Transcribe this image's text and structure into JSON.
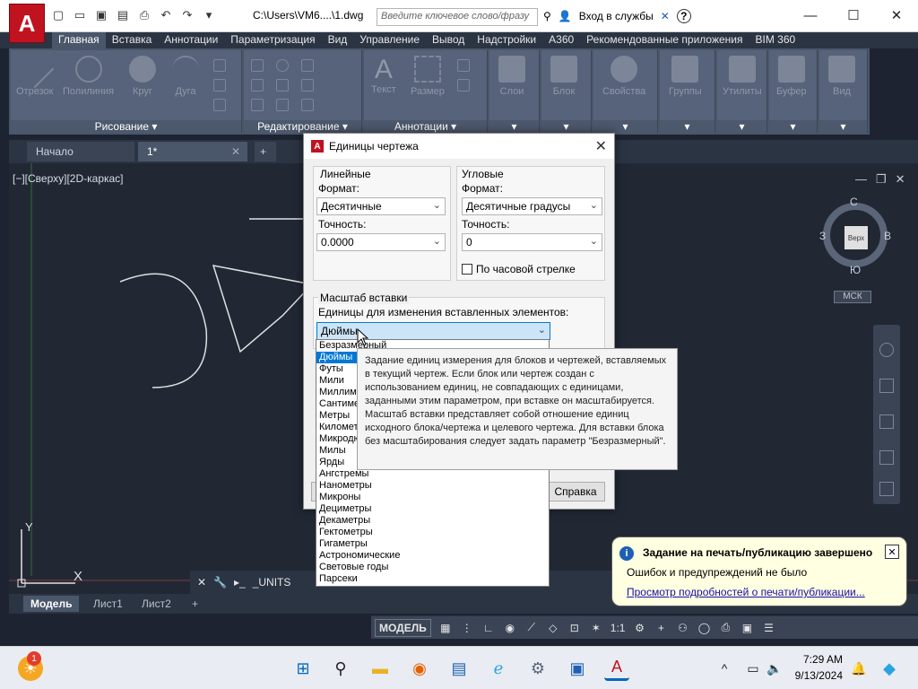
{
  "window": {
    "doc_title": "C:\\Users\\VM6....\\1.dwg",
    "search_placeholder": "Введите ключевое слово/фразу",
    "sign_in": "Вход в службы",
    "help": "?"
  },
  "ribbon": {
    "tabs": [
      "Главная",
      "Вставка",
      "Аннотации",
      "Параметризация",
      "Вид",
      "Управление",
      "Вывод",
      "Надстройки",
      "A360",
      "Рекомендованные приложения",
      "BIM 360"
    ],
    "active_tab": 0,
    "panels": {
      "draw": {
        "title": "Рисование",
        "buttons": [
          "Отрезок",
          "Полилиния",
          "Круг",
          "Дуга"
        ]
      },
      "modify": {
        "title": "Редактирование"
      },
      "annotation": {
        "title": "Аннотации",
        "buttons": [
          "Текст",
          "Размер"
        ]
      },
      "others": [
        "Слои",
        "Блок",
        "Свойства",
        "Группы",
        "Утилиты",
        "Буфер",
        "Вид"
      ]
    }
  },
  "file_tabs": [
    "Начало",
    "1*"
  ],
  "viewport": {
    "label": "[−][Сверху][2D-каркас]",
    "viewcube": {
      "top": "Верх",
      "n": "С",
      "s": "Ю",
      "w": "З",
      "e": "В"
    },
    "ucs": "МСК",
    "axis_y": "Y",
    "axis_x": "X"
  },
  "layout_tabs": [
    "Модель",
    "Лист1",
    "Лист2"
  ],
  "status": {
    "model": "МОДЕЛЬ",
    "scale": "1:1"
  },
  "command_line": {
    "text": "_UNITS"
  },
  "dialog": {
    "title": "Единицы чертежа",
    "linear": {
      "title": "Линейные",
      "format_label": "Формат:",
      "format_value": "Десятичные",
      "precision_label": "Точность:",
      "precision_value": "0.0000"
    },
    "angular": {
      "title": "Угловые",
      "format_label": "Формат:",
      "format_value": "Десятичные градусы",
      "precision_label": "Точность:",
      "precision_value": "0",
      "clockwise_label": "По часовой стрелке"
    },
    "insert": {
      "title": "Масштаб вставки",
      "units_label": "Единицы для изменения вставленных элементов:",
      "units_value": "Дюймы"
    },
    "help_button": "Справка",
    "unit_options": [
      "Безразмерный",
      "Дюймы",
      "Футы",
      "Мили",
      "Миллиметры",
      "Сантиметры",
      "Метры",
      "Километры",
      "Микродюймы",
      "Милы",
      "Ярды",
      "Ангстремы",
      "Нанометры",
      "Микроны",
      "Дециметры",
      "Декаметры",
      "Гектометры",
      "Гигаметры",
      "Астрономические",
      "Световые годы",
      "Парсеки"
    ],
    "selected_option": 1
  },
  "tooltip": {
    "text": "Задание единиц измерения для блоков и чертежей, вставляемых в текущий чертеж. Если блок или чертеж создан с использованием единиц, не совпадающих с единицами, заданными этим параметром, при вставке он масштабируется. Масштаб вставки представляет собой отношение единиц исходного блока/чертежа и целевого чертежа. Для вставки блока без масштабирования следует задать параметр \"Безразмерный\"."
  },
  "notification": {
    "title": "Задание на печать/публикацию завершено",
    "message": "Ошибок и предупреждений не было",
    "link": "Просмотр подробностей о печати/публикации..."
  },
  "taskbar": {
    "badge": "1",
    "time": "7:29 AM",
    "date": "9/13/2024"
  },
  "colors": {
    "accent": "#c1121f",
    "ribbon_bg": "#4a5669",
    "canvas_bg": "#212834",
    "selection": "#0078d7"
  }
}
